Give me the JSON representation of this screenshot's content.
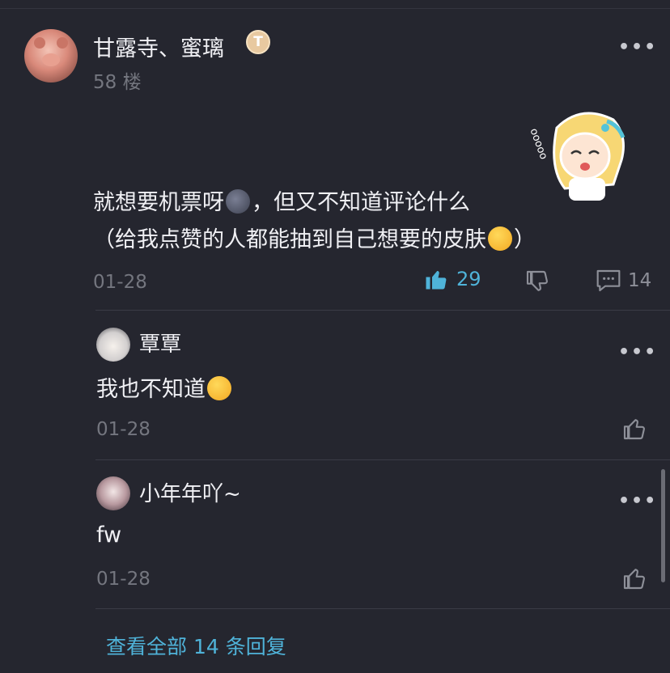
{
  "post": {
    "username": "甘露寺、蜜璃",
    "badge": "T",
    "floor": "58 楼",
    "line1_a": "就想要机票呀",
    "line1_b": "，但又不知道评论什么",
    "line2_a": "（给我点赞的人都能抽到自己想要的皮肤",
    "line2_b": "）",
    "emoji1": "new-moon-face",
    "emoji2": "smirking-face",
    "date": "01-28",
    "likes": "29",
    "comments": "14"
  },
  "replies": [
    {
      "name": "覃覃",
      "text": "我也不知道",
      "emoji": "upside-down-face",
      "date": "01-28"
    },
    {
      "name": "小年年吖~",
      "text": "fw",
      "date": "01-28"
    }
  ],
  "view_all": "查看全部 14 条回复",
  "colors": {
    "accent": "#4fb3d9",
    "background": "#25262f",
    "muted": "#74767f"
  }
}
